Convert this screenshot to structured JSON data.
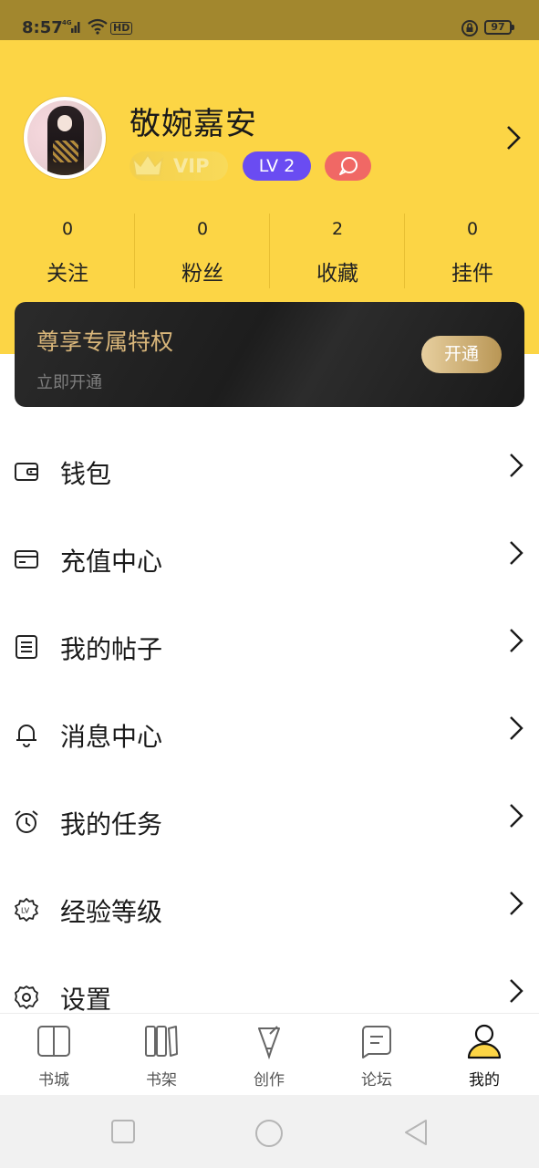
{
  "status_bar": {
    "time": "8:57",
    "network": "4G",
    "hd": "HD",
    "battery": "97"
  },
  "profile": {
    "username": "敬婉嘉安",
    "vip_label": "VIP",
    "level_label": "LV 2"
  },
  "stats": [
    {
      "value": "0",
      "label": "关注"
    },
    {
      "value": "0",
      "label": "粉丝"
    },
    {
      "value": "2",
      "label": "收藏"
    },
    {
      "value": "0",
      "label": "挂件"
    }
  ],
  "vip_card": {
    "title": "尊享专属特权",
    "subtitle": "立即开通",
    "button": "开通"
  },
  "menu": [
    {
      "label": "钱包",
      "icon": "wallet-icon"
    },
    {
      "label": "充值中心",
      "icon": "card-icon"
    },
    {
      "label": "我的帖子",
      "icon": "document-icon"
    },
    {
      "label": "消息中心",
      "icon": "bell-icon"
    },
    {
      "label": "我的任务",
      "icon": "alarm-clock-icon"
    },
    {
      "label": "经验等级",
      "icon": "level-badge-icon"
    },
    {
      "label": "设置",
      "icon": "gear-icon"
    }
  ],
  "bottom_nav": [
    {
      "label": "书城",
      "icon": "book-open-icon",
      "active": false
    },
    {
      "label": "书架",
      "icon": "bookshelf-icon",
      "active": false
    },
    {
      "label": "创作",
      "icon": "pen-icon",
      "active": false
    },
    {
      "label": "论坛",
      "icon": "forum-icon",
      "active": false
    },
    {
      "label": "我的",
      "icon": "user-icon",
      "active": true
    }
  ],
  "colors": {
    "header_bg": "#fcd545",
    "level_badge": "#6a4cf2",
    "chat_badge": "#f06865",
    "vip_card_bg": "#1f1f1f",
    "vip_gold": "#d9b67a"
  }
}
